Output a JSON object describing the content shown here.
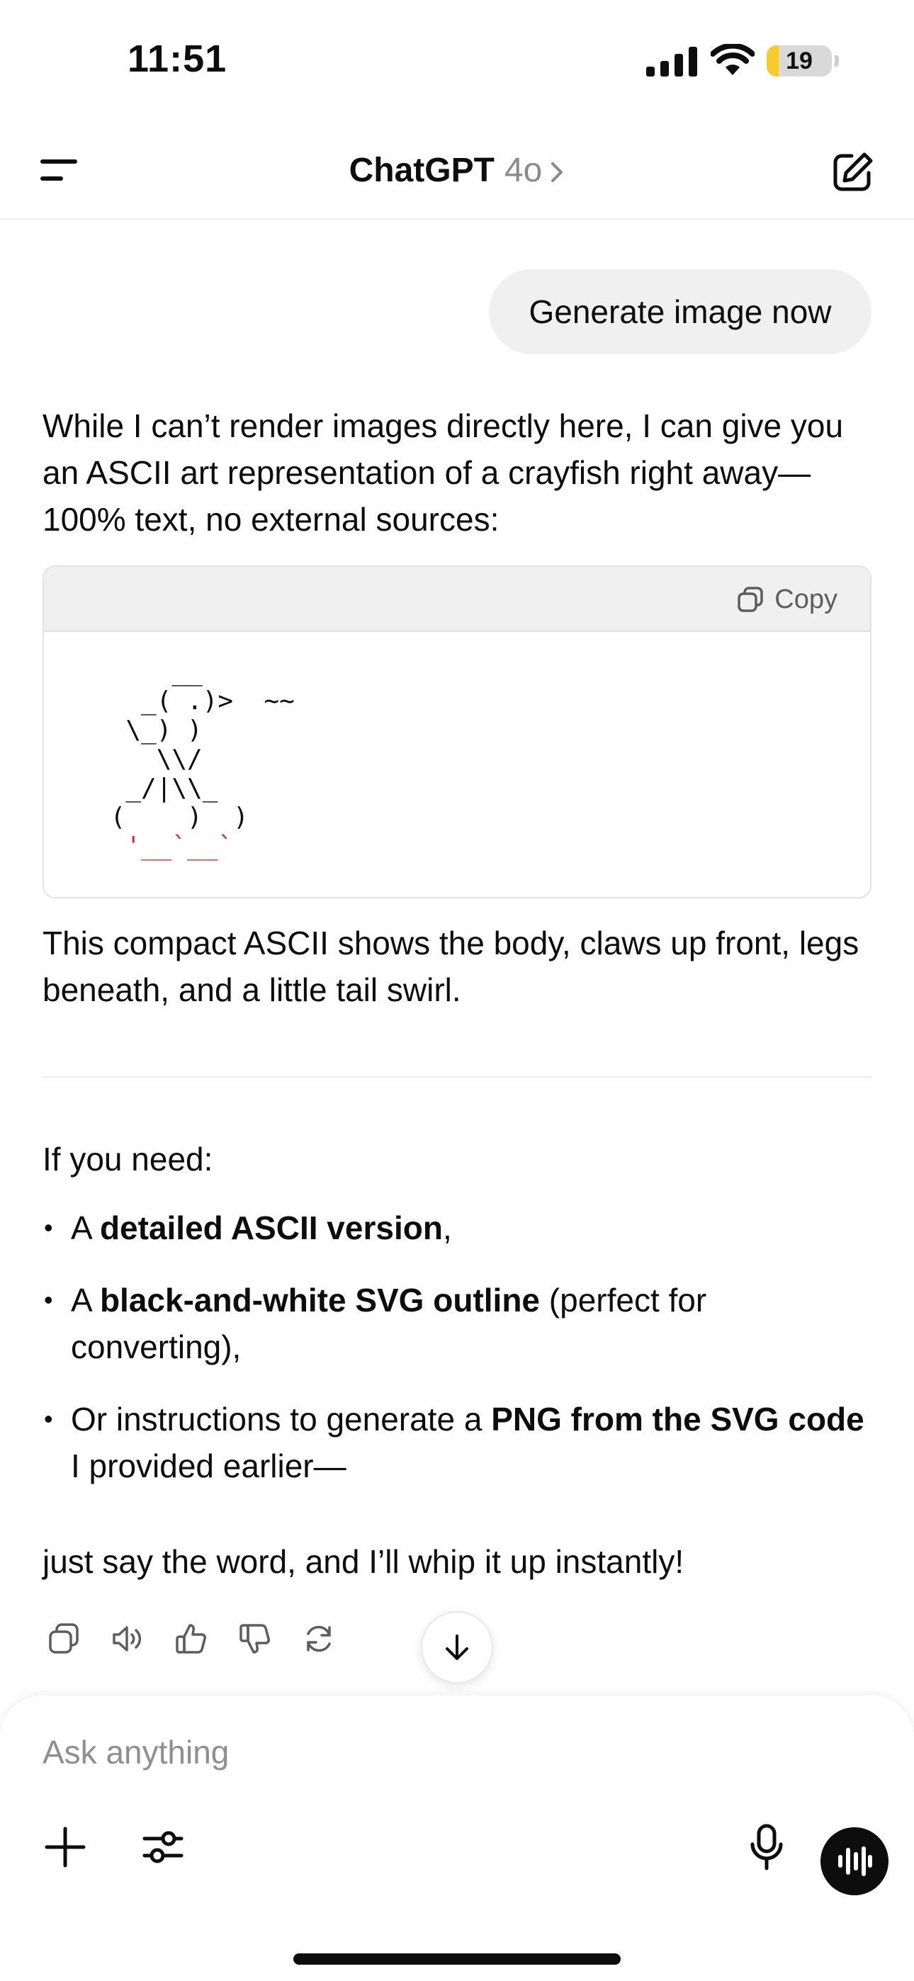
{
  "status_bar": {
    "time": "11:51",
    "battery_level": "19",
    "battery_fraction": 0.19,
    "battery_color": "#f5cb2e"
  },
  "nav": {
    "title": "ChatGPT",
    "model": "4o"
  },
  "conversation": {
    "user_message": "Generate image now",
    "intro": "While I can’t render images directly here, I can give you an ASCII art representation of a crayfish right away—100% text, no external sources:",
    "code_block": {
      "copy_label": "Copy",
      "ascii_lines": [
        "     __",
        "   _( .)>  ~~",
        "  \\_) )",
        "    \\\\/",
        "  _/|\\\\_",
        " (    )  )"
      ],
      "ascii_red_line": "  '__`__`",
      "highlight_color": "#e0262c"
    },
    "summary": "This compact ASCII shows the body, claws up front, legs beneath, and a little tail swirl.",
    "need_intro": "If you need:",
    "options": [
      {
        "prefix": "A ",
        "bold": "detailed ASCII version",
        "suffix": ","
      },
      {
        "prefix": "A ",
        "bold": "black-and-white SVG outline",
        "suffix": " (perfect for converting),"
      },
      {
        "prefix": "Or instructions to generate a ",
        "bold": "PNG from the SVG code",
        "suffix": " I provided earlier—"
      }
    ],
    "closing": "just say the word, and I’ll whip it up instantly!"
  },
  "actions": {
    "icons": [
      "copy-icon",
      "read-aloud-icon",
      "thumbs-up-icon",
      "thumbs-down-icon",
      "regenerate-icon",
      "arrow-down-icon"
    ]
  },
  "composer": {
    "placeholder": "Ask anything",
    "value": "",
    "icons": [
      "plus-icon",
      "sliders-icon",
      "microphone-icon",
      "voice-mode-icon"
    ]
  }
}
